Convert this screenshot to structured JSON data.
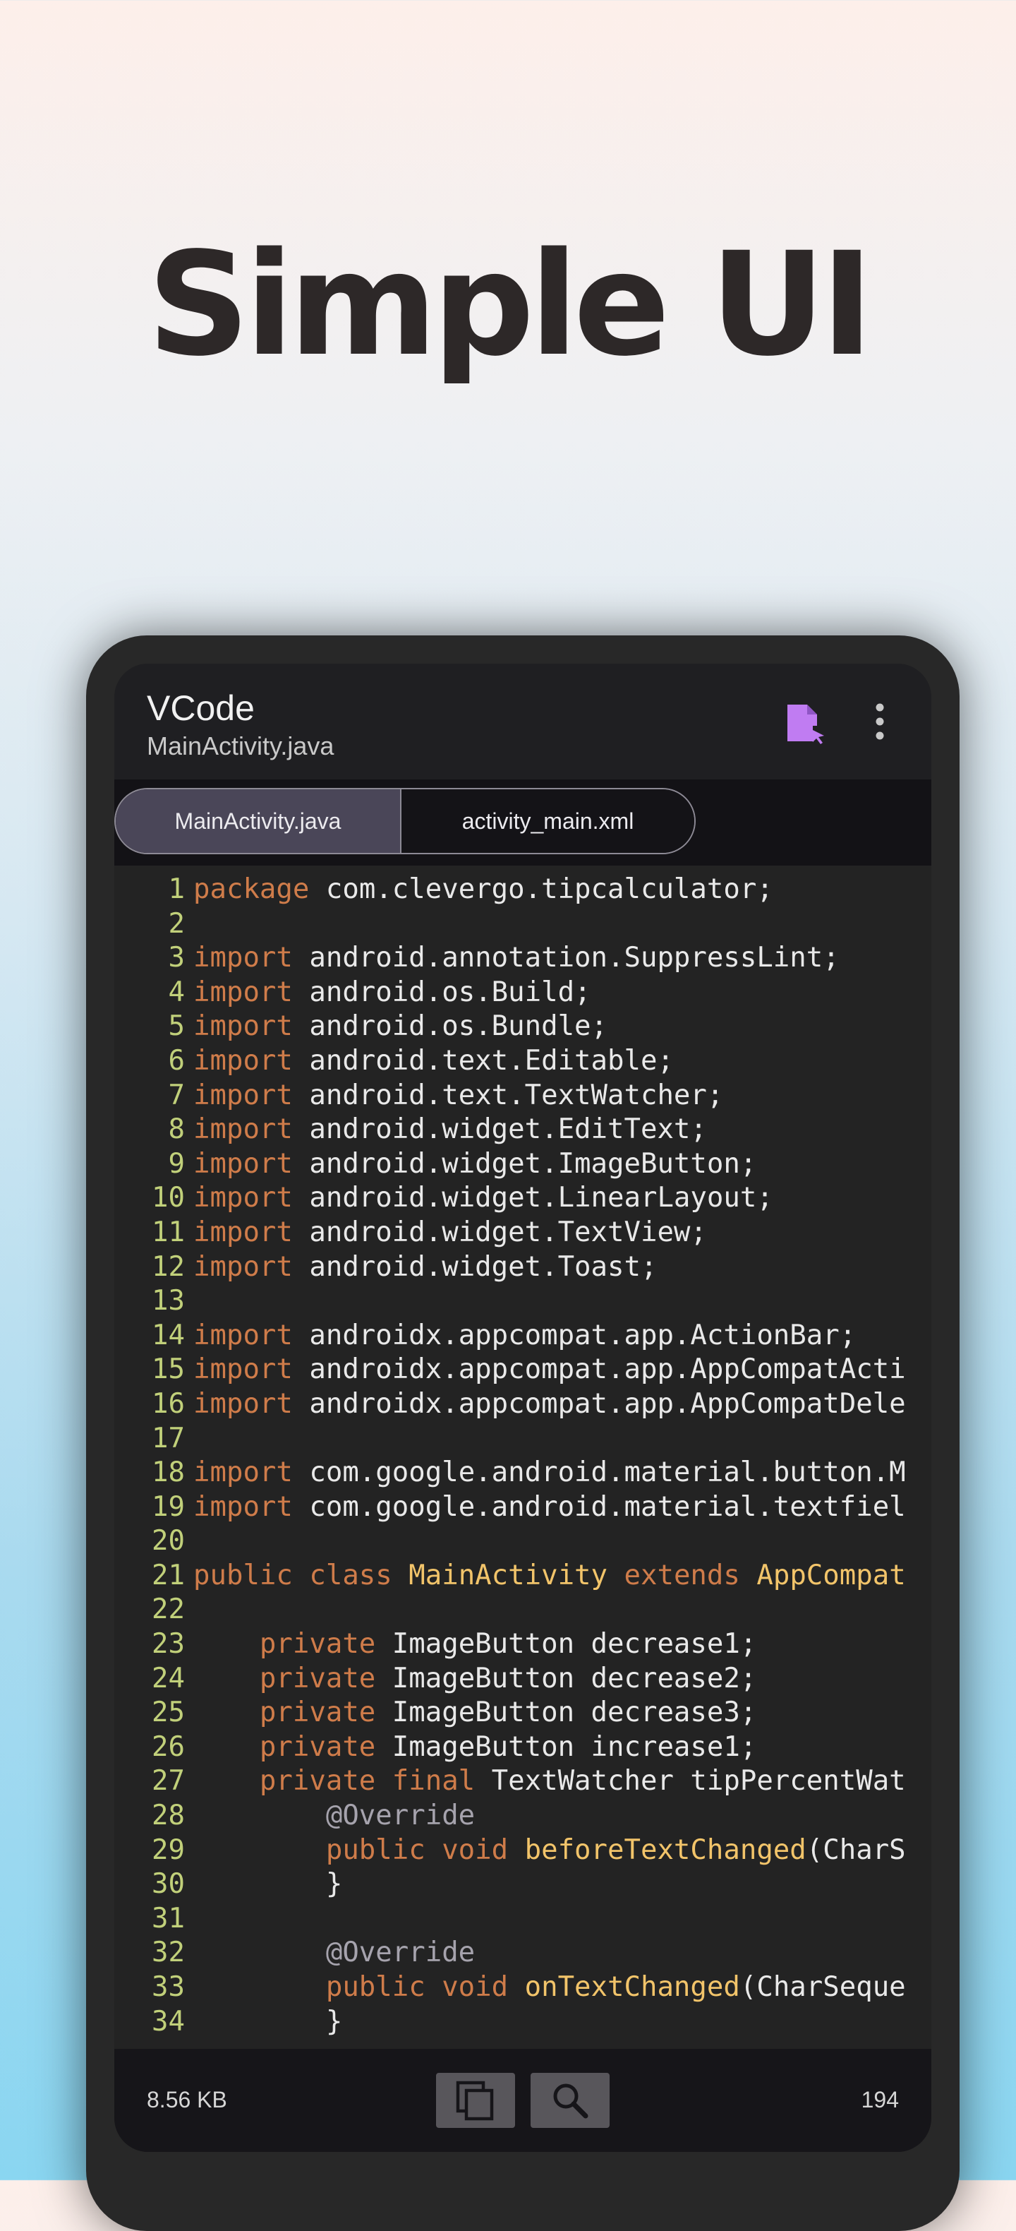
{
  "headline": "Simple UI",
  "app": {
    "title": "VCode",
    "subtitle": "MainActivity.java",
    "accent": "#c07cf2"
  },
  "tabs": [
    {
      "label": "MainActivity.java",
      "active": true
    },
    {
      "label": "activity_main.xml",
      "active": false
    }
  ],
  "editor": {
    "lines": [
      {
        "n": "1",
        "tokens": [
          [
            "kw",
            "package"
          ],
          [
            "id",
            " com.clevergo.tipcalculator;"
          ]
        ]
      },
      {
        "n": "2",
        "tokens": []
      },
      {
        "n": "3",
        "tokens": [
          [
            "kw",
            "import"
          ],
          [
            "id",
            " android.annotation.SuppressLint;"
          ]
        ]
      },
      {
        "n": "4",
        "tokens": [
          [
            "kw",
            "import"
          ],
          [
            "id",
            " android.os.Build;"
          ]
        ]
      },
      {
        "n": "5",
        "tokens": [
          [
            "kw",
            "import"
          ],
          [
            "id",
            " android.os.Bundle;"
          ]
        ]
      },
      {
        "n": "6",
        "tokens": [
          [
            "kw",
            "import"
          ],
          [
            "id",
            " android.text.Editable;"
          ]
        ]
      },
      {
        "n": "7",
        "tokens": [
          [
            "kw",
            "import"
          ],
          [
            "id",
            " android.text.TextWatcher;"
          ]
        ]
      },
      {
        "n": "8",
        "tokens": [
          [
            "kw",
            "import"
          ],
          [
            "id",
            " android.widget.EditText;"
          ]
        ]
      },
      {
        "n": "9",
        "tokens": [
          [
            "kw",
            "import"
          ],
          [
            "id",
            " android.widget.ImageButton;"
          ]
        ]
      },
      {
        "n": "10",
        "tokens": [
          [
            "kw",
            "import"
          ],
          [
            "id",
            " android.widget.LinearLayout;"
          ]
        ]
      },
      {
        "n": "11",
        "tokens": [
          [
            "kw",
            "import"
          ],
          [
            "id",
            " android.widget.TextView;"
          ]
        ]
      },
      {
        "n": "12",
        "tokens": [
          [
            "kw",
            "import"
          ],
          [
            "id",
            " android.widget.Toast;"
          ]
        ]
      },
      {
        "n": "13",
        "tokens": []
      },
      {
        "n": "14",
        "tokens": [
          [
            "kw",
            "import"
          ],
          [
            "id",
            " androidx.appcompat.app.ActionBar;"
          ]
        ]
      },
      {
        "n": "15",
        "tokens": [
          [
            "kw",
            "import"
          ],
          [
            "id",
            " androidx.appcompat.app.AppCompatActi"
          ]
        ]
      },
      {
        "n": "16",
        "tokens": [
          [
            "kw",
            "import"
          ],
          [
            "id",
            " androidx.appcompat.app.AppCompatDele"
          ]
        ]
      },
      {
        "n": "17",
        "tokens": []
      },
      {
        "n": "18",
        "tokens": [
          [
            "kw",
            "import"
          ],
          [
            "id",
            " com.google.android.material.button.M"
          ]
        ]
      },
      {
        "n": "19",
        "tokens": [
          [
            "kw",
            "import"
          ],
          [
            "id",
            " com.google.android.material.textfiel"
          ]
        ]
      },
      {
        "n": "20",
        "tokens": []
      },
      {
        "n": "21",
        "tokens": [
          [
            "kw",
            "public class"
          ],
          [
            "id",
            " "
          ],
          [
            "cls",
            "MainActivity"
          ],
          [
            "id",
            " "
          ],
          [
            "kw",
            "extends"
          ],
          [
            "id",
            " "
          ],
          [
            "cls",
            "AppCompat"
          ]
        ]
      },
      {
        "n": "22",
        "tokens": []
      },
      {
        "n": "23",
        "tokens": [
          [
            "id",
            "    "
          ],
          [
            "kw",
            "private"
          ],
          [
            "id",
            " ImageButton decrease1;"
          ]
        ]
      },
      {
        "n": "24",
        "tokens": [
          [
            "id",
            "    "
          ],
          [
            "kw",
            "private"
          ],
          [
            "id",
            " ImageButton decrease2;"
          ]
        ]
      },
      {
        "n": "25",
        "tokens": [
          [
            "id",
            "    "
          ],
          [
            "kw",
            "private"
          ],
          [
            "id",
            " ImageButton decrease3;"
          ]
        ]
      },
      {
        "n": "26",
        "tokens": [
          [
            "id",
            "    "
          ],
          [
            "kw",
            "private"
          ],
          [
            "id",
            " ImageButton increase1;"
          ]
        ]
      },
      {
        "n": "27",
        "tokens": [
          [
            "id",
            "    "
          ],
          [
            "kw",
            "private final"
          ],
          [
            "id",
            " TextWatcher tipPercentWat"
          ]
        ]
      },
      {
        "n": "28",
        "tokens": [
          [
            "id",
            "        "
          ],
          [
            "ann",
            "@Override"
          ]
        ]
      },
      {
        "n": "29",
        "tokens": [
          [
            "id",
            "        "
          ],
          [
            "kw",
            "public void"
          ],
          [
            "id",
            " "
          ],
          [
            "fn",
            "beforeTextChanged"
          ],
          [
            "id",
            "(CharS"
          ]
        ]
      },
      {
        "n": "30",
        "tokens": [
          [
            "id",
            "        }"
          ]
        ]
      },
      {
        "n": "31",
        "tokens": []
      },
      {
        "n": "32",
        "tokens": [
          [
            "id",
            "        "
          ],
          [
            "ann",
            "@Override"
          ]
        ]
      },
      {
        "n": "33",
        "tokens": [
          [
            "id",
            "        "
          ],
          [
            "kw",
            "public void"
          ],
          [
            "id",
            " "
          ],
          [
            "fn",
            "onTextChanged"
          ],
          [
            "id",
            "(CharSeque"
          ]
        ]
      },
      {
        "n": "34",
        "tokens": [
          [
            "id",
            "        }"
          ]
        ]
      }
    ]
  },
  "status": {
    "file_size": "8.56 KB",
    "line_count": "194"
  },
  "icons": {
    "file": "file-cursor-icon",
    "more": "more-vert-icon",
    "copy": "copy-icon",
    "search": "search-icon"
  }
}
